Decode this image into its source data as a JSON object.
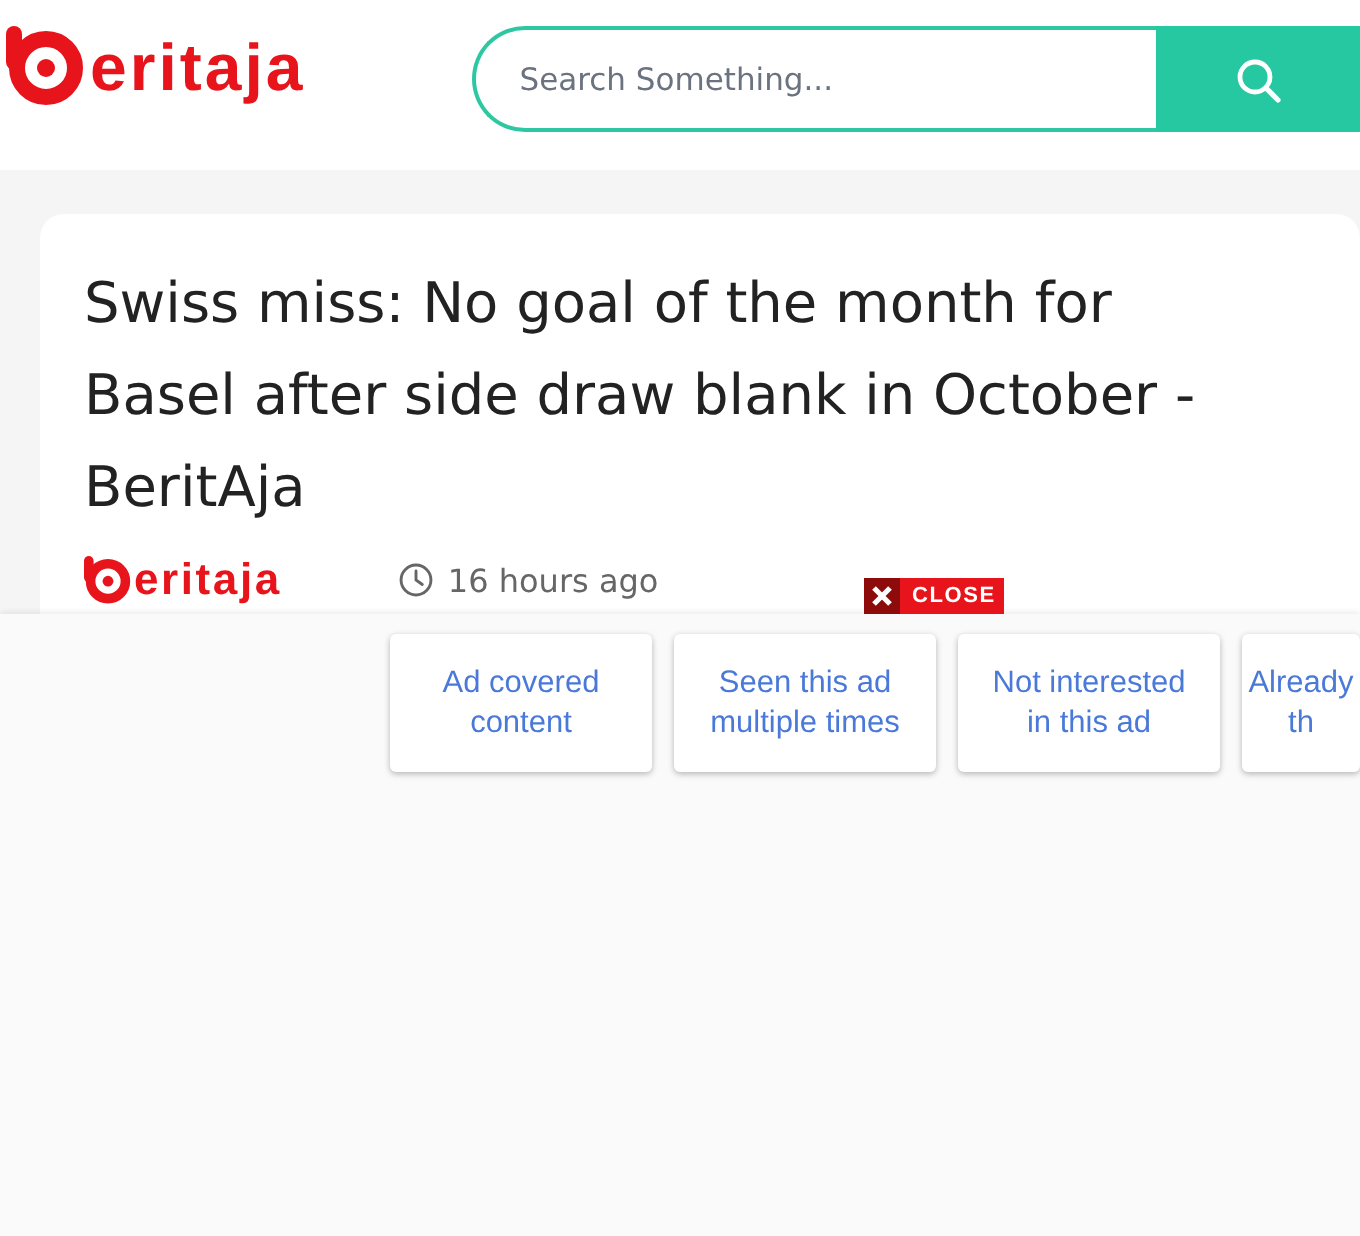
{
  "header": {
    "logo": {
      "text": "eritaja"
    },
    "search": {
      "placeholder": "Search Something..."
    }
  },
  "article": {
    "title": "Swiss miss: No goal of the month for Basel after side draw blank in October - BeritAja",
    "source_logo": {
      "text": "eritaja"
    },
    "time": "16 hours ago"
  },
  "ad_overlay": {
    "close": {
      "label": "CLOSE"
    },
    "options": [
      {
        "label": "Ad covered content"
      },
      {
        "label": "Seen this ad multiple times"
      },
      {
        "label": "Not interested in this ad"
      },
      {
        "label": "Already th"
      }
    ]
  }
}
